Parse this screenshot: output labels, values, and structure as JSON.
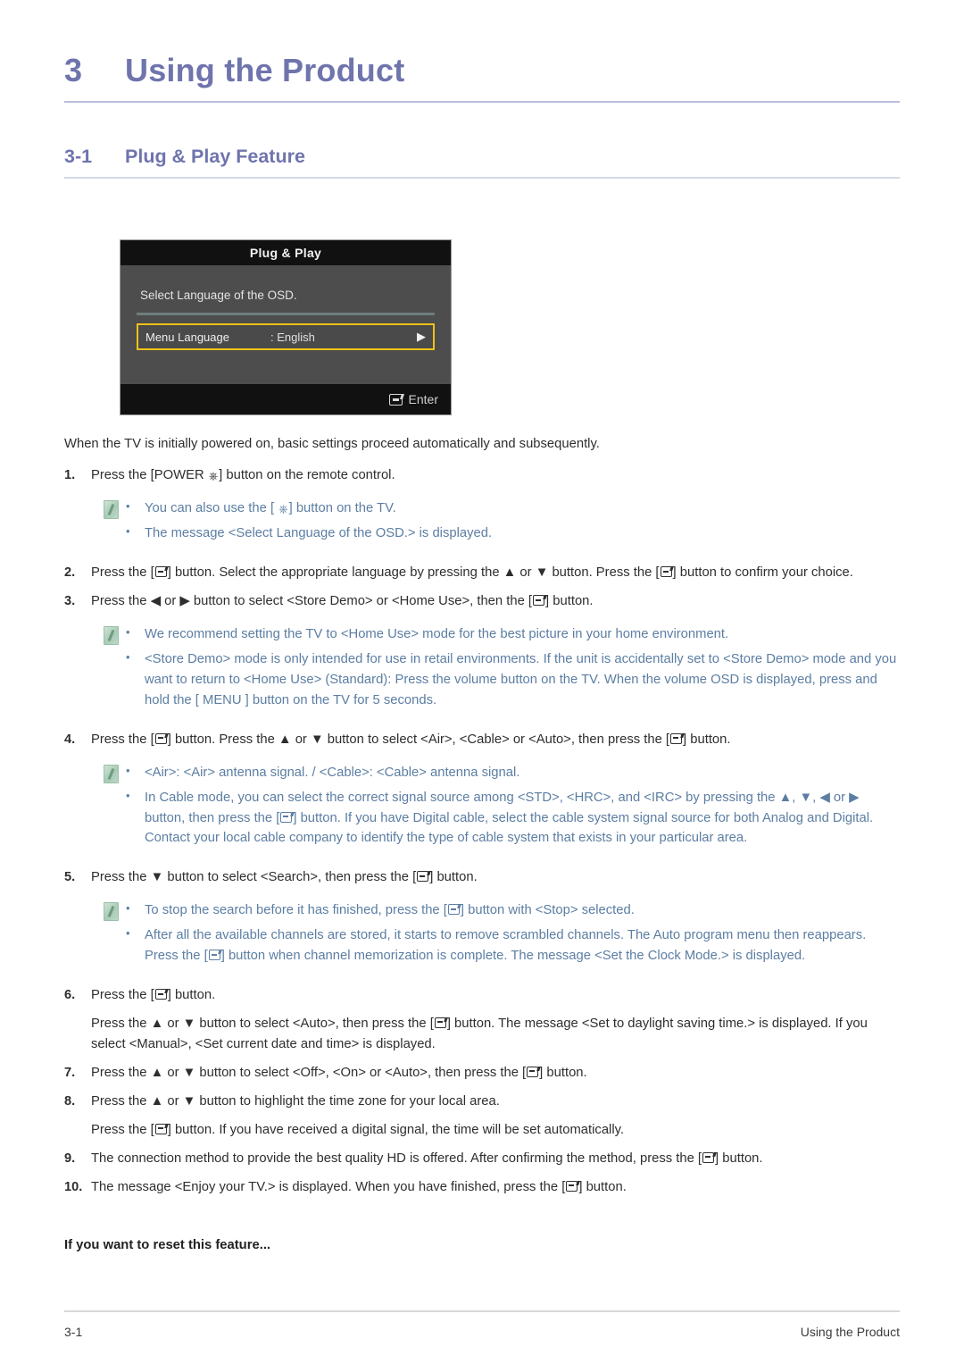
{
  "chapter": {
    "number": "3",
    "title": "Using the Product"
  },
  "section": {
    "number": "3-1",
    "title": "Plug & Play Feature"
  },
  "osd": {
    "title": "Plug & Play",
    "prompt": "Select Language of the OSD.",
    "row_label": "Menu Language",
    "row_value": ": English",
    "row_arrow": "▶",
    "footer_label": "Enter",
    "enter_icon": "enter-key-icon",
    "colors": {
      "highlight_border": "#edc216",
      "panel_background": "#4d4d4d",
      "titlebar_background": "#111111",
      "divider": "#6f7d7d"
    }
  },
  "intro": "When the TV is initially powered on, basic settings proceed automatically and subsequently.",
  "steps": [
    {
      "number": "1.",
      "text_before_power": "Press the [POWER ",
      "text_after_power": "] button on the remote control."
    },
    {
      "number": "2.",
      "seg1": "Press the [",
      "seg2": "] button. Select the appropriate language by pressing the ▲ or ▼ button. Press the [",
      "seg3": "] button to confirm your choice."
    },
    {
      "number": "3.",
      "seg1": "Press the ◀ or ▶ button to select <Store Demo> or <Home Use>, then the [",
      "seg2": "] button."
    },
    {
      "number": "4.",
      "seg1": "Press the [",
      "seg2": "] button. Press the ▲ or ▼ button to select <Air>, <Cable> or <Auto>, then press the [",
      "seg3": "] button."
    },
    {
      "number": "5.",
      "seg1": "Press the ▼ button to select <Search>, then press the [",
      "seg2": "] button."
    },
    {
      "number": "6.",
      "seg1": "Press the [",
      "seg2": "] button."
    },
    {
      "number": "7.",
      "seg1": " Press the ▲ or ▼ button to select <Off>, <On> or <Auto>, then press the [",
      "seg2": "] button."
    },
    {
      "number": "8.",
      "seg1": "Press the ▲ or ▼ button to highlight the time zone for your local area."
    },
    {
      "number": "9.",
      "seg1": "The connection method to provide the best quality HD is offered. After confirming the method, press the [",
      "seg2": "] button."
    },
    {
      "number": "10.",
      "seg1": "The message <Enjoy your TV.> is displayed. When you have finished, press the [",
      "seg2": "] button."
    }
  ],
  "substeps": {
    "after_six_a": "Press the ▲ or ▼ button to select <Auto>, then press the [",
    "after_six_b": "] button. The message <Set to daylight saving time.> is displayed. If you select <Manual>, <Set current date and time> is displayed.",
    "after_eight_a": "Press the [",
    "after_eight_b": "] button. If you have received a digital signal, the time will be set automatically."
  },
  "notes": {
    "note1": {
      "icon": "note-pencil-icon",
      "item1_seg1": "You can also use the [ ",
      "item1_seg2": "] button on the TV.",
      "item2": "The message <Select Language of the OSD.> is displayed."
    },
    "note2": {
      "icon": "note-pencil-icon",
      "item1": "We recommend setting the TV to <Home Use> mode for the best picture in your home environment.",
      "item2": "<Store Demo> mode is only intended for use in retail environments. If the unit is accidentally set to <Store Demo> mode and you want to return to <Home Use> (Standard): Press the volume button on the TV. When the volume OSD is displayed, press and hold the [ MENU ] button on the TV for 5 seconds."
    },
    "note3": {
      "icon": "note-pencil-icon",
      "item1": "<Air>: <Air> antenna signal. / <Cable>: <Cable> antenna signal.",
      "item2_seg1": "In Cable mode, you can select the correct signal source among <STD>, <HRC>, and <IRC> by pressing the ▲, ▼, ◀ or ▶ button, then press the [",
      "item2_seg2": "] button. If you have Digital cable, select the cable system signal source for both Analog and Digital. Contact your local cable company to identify the type of cable system that exists in your particular area."
    },
    "note4": {
      "icon": "note-pencil-icon",
      "item1_seg1": "To stop the search before it has finished, press the [",
      "item1_seg2": "] button with <Stop> selected.",
      "item2_seg1": "After all the available channels are stored, it starts to remove scrambled channels. The Auto program menu then reappears. Press the [",
      "item2_seg2": "] button when channel memorization is complete. The message <Set the Clock Mode.> is displayed."
    }
  },
  "reset_heading": "If you want to reset this feature...",
  "footer": {
    "page_number": "3-1",
    "chapter_name": "Using the Product"
  },
  "theme": {
    "heading_color": "#6f74ad",
    "note_text_color": "#5c7ea3",
    "body_text_color": "#2e2e2e"
  }
}
